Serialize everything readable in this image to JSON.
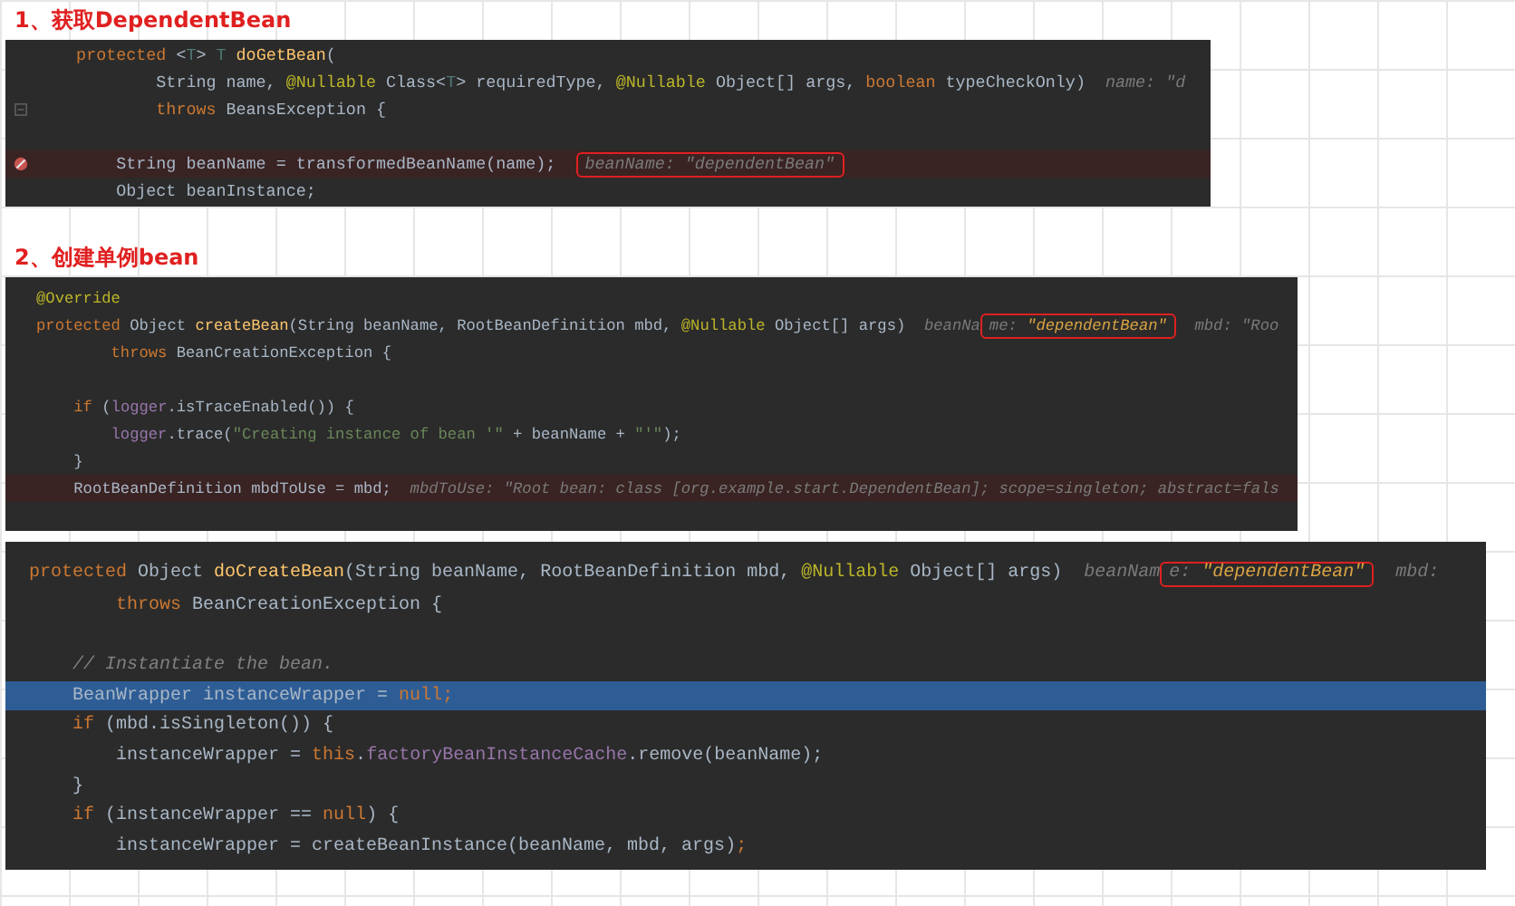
{
  "sections": [
    {
      "heading": "1、获取DependentBean",
      "lines": [
        {
          "kind": "code",
          "tokens": [
            {
              "text": "    protected ",
              "kind": "keyword"
            },
            {
              "text": "<",
              "kind": "plain"
            },
            {
              "text": "T",
              "kind": "typeparam"
            },
            {
              "text": "> ",
              "kind": "plain"
            },
            {
              "text": "T ",
              "kind": "typeparam"
            },
            {
              "text": "doGetBean",
              "kind": "function"
            },
            {
              "text": "(",
              "kind": "plain"
            }
          ]
        },
        {
          "kind": "code",
          "tokens": [
            {
              "text": "            String name, ",
              "kind": "plain"
            },
            {
              "text": "@Nullable ",
              "kind": "annotation"
            },
            {
              "text": "Class<",
              "kind": "plain"
            },
            {
              "text": "T",
              "kind": "typeparam"
            },
            {
              "text": "> requiredType, ",
              "kind": "plain"
            },
            {
              "text": "@Nullable ",
              "kind": "annotation"
            },
            {
              "text": "Object[] args, ",
              "kind": "plain"
            },
            {
              "text": "boolean ",
              "kind": "keyword"
            },
            {
              "text": "typeCheckOnly)  ",
              "kind": "plain"
            },
            {
              "text": "name: \"d",
              "kind": "hint"
            }
          ]
        },
        {
          "kind": "code",
          "fold": true,
          "tokens": [
            {
              "text": "            throws ",
              "kind": "keyword"
            },
            {
              "text": "BeansException {",
              "kind": "plain"
            }
          ]
        },
        {
          "kind": "blank"
        },
        {
          "kind": "breakpoint",
          "breakpoint": true,
          "tokens": [
            {
              "text": "        String beanName = transformedBeanName(name);  ",
              "kind": "plain"
            },
            {
              "kind": "box",
              "box": [
                {
                  "text": "beanName: \"dependentBean\"",
                  "kind": "hint"
                }
              ]
            }
          ]
        },
        {
          "kind": "code",
          "tokens": [
            {
              "text": "        Object beanInstance;",
              "kind": "plain"
            }
          ]
        }
      ]
    },
    {
      "heading": "2、创建单例bean",
      "lines": [
        {
          "kind": "code",
          "tokens": [
            {
              "text": "@Override",
              "kind": "annotation"
            }
          ]
        },
        {
          "kind": "code",
          "tokens": [
            {
              "text": "protected ",
              "kind": "keyword"
            },
            {
              "text": "Object ",
              "kind": "plain"
            },
            {
              "text": "createBean",
              "kind": "function"
            },
            {
              "text": "(String beanName, RootBeanDefinition mbd, ",
              "kind": "plain"
            },
            {
              "text": "@Nullable ",
              "kind": "annotation"
            },
            {
              "text": "Object[] args)  ",
              "kind": "plain"
            },
            {
              "text": "beanNa",
              "kind": "hint"
            },
            {
              "kind": "box",
              "box": [
                {
                  "text": "me: ",
                  "kind": "hint"
                },
                {
                  "text": "\"dependentBean\"",
                  "kind": "hintvalue"
                }
              ]
            },
            {
              "text": "  mbd: \"Roo",
              "kind": "hint"
            }
          ]
        },
        {
          "kind": "code",
          "tokens": [
            {
              "text": "        throws ",
              "kind": "keyword"
            },
            {
              "text": "BeanCreationException {",
              "kind": "plain"
            }
          ]
        },
        {
          "kind": "blank"
        },
        {
          "kind": "code",
          "tokens": [
            {
              "text": "    if ",
              "kind": "keyword"
            },
            {
              "text": "(",
              "kind": "plain"
            },
            {
              "text": "logger",
              "kind": "field"
            },
            {
              "text": ".isTraceEnabled()) {",
              "kind": "plain"
            }
          ]
        },
        {
          "kind": "code",
          "tokens": [
            {
              "text": "        logger",
              "kind": "field"
            },
            {
              "text": ".trace(",
              "kind": "plain"
            },
            {
              "text": "\"Creating instance of bean '\"",
              "kind": "string"
            },
            {
              "text": " + beanName + ",
              "kind": "plain"
            },
            {
              "text": "\"'\"",
              "kind": "string"
            },
            {
              "text": ");",
              "kind": "plain"
            }
          ]
        },
        {
          "kind": "code",
          "tokens": [
            {
              "text": "    }",
              "kind": "plain"
            }
          ]
        },
        {
          "kind": "breakpoint",
          "tokens": [
            {
              "text": "    RootBeanDefinition mbdToUse = mbd;  ",
              "kind": "plain"
            },
            {
              "text": "mbdToUse: \"Root bean: class [org.example.start.DependentBean]; scope=singleton; abstract=fals",
              "kind": "hint"
            }
          ]
        },
        {
          "kind": "blank"
        }
      ]
    },
    {
      "lines": [
        {
          "kind": "code",
          "tokens": [
            {
              "text": "protected ",
              "kind": "keyword"
            },
            {
              "text": "Object ",
              "kind": "plain"
            },
            {
              "text": "doCreateBean",
              "kind": "function"
            },
            {
              "text": "(String beanName, RootBeanDefinition mbd, ",
              "kind": "plain"
            },
            {
              "text": "@Nullable ",
              "kind": "annotation"
            },
            {
              "text": "Object[] args)  ",
              "kind": "plain"
            },
            {
              "text": "beanNam",
              "kind": "hint"
            },
            {
              "kind": "box",
              "box": [
                {
                  "text": "e: ",
                  "kind": "hint"
                },
                {
                  "text": "\"dependentBean\"",
                  "kind": "hintvalue"
                }
              ]
            },
            {
              "text": "  mbd:",
              "kind": "hint"
            }
          ]
        },
        {
          "kind": "code",
          "tokens": [
            {
              "text": "        throws ",
              "kind": "keyword"
            },
            {
              "text": "BeanCreationException {",
              "kind": "plain"
            }
          ]
        },
        {
          "kind": "blank"
        },
        {
          "kind": "code",
          "tokens": [
            {
              "text": "    // Instantiate the bean.",
              "kind": "comment"
            }
          ]
        },
        {
          "kind": "caret",
          "tokens": [
            {
              "text": "    BeanWrapper instanceWrapper = ",
              "kind": "plain"
            },
            {
              "text": "null",
              "kind": "keyword"
            },
            {
              "text": ";",
              "kind": "keyword"
            }
          ]
        },
        {
          "kind": "code",
          "tokens": [
            {
              "text": "    if ",
              "kind": "keyword"
            },
            {
              "text": "(mbd.isSingleton()) {",
              "kind": "plain"
            }
          ]
        },
        {
          "kind": "code",
          "tokens": [
            {
              "text": "        instanceWrapper = ",
              "kind": "plain"
            },
            {
              "text": "this",
              "kind": "keyword"
            },
            {
              "text": ".",
              "kind": "plain"
            },
            {
              "text": "factoryBeanInstanceCache",
              "kind": "field"
            },
            {
              "text": ".remove(beanName);",
              "kind": "plain"
            }
          ]
        },
        {
          "kind": "code",
          "tokens": [
            {
              "text": "    }",
              "kind": "plain"
            }
          ]
        },
        {
          "kind": "code",
          "tokens": [
            {
              "text": "    if ",
              "kind": "keyword"
            },
            {
              "text": "(instanceWrapper == ",
              "kind": "plain"
            },
            {
              "text": "null",
              "kind": "keyword"
            },
            {
              "text": ") {",
              "kind": "plain"
            }
          ]
        },
        {
          "kind": "code",
          "tokens": [
            {
              "text": "        instanceWrapper = createBeanInstance(beanName, mbd, args)",
              "kind": "plain"
            },
            {
              "text": ";",
              "kind": "keyword"
            }
          ]
        }
      ]
    }
  ]
}
